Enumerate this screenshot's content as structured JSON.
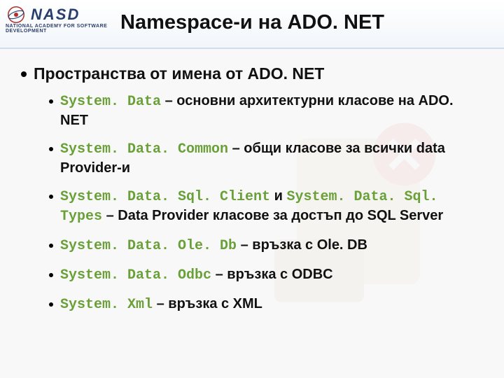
{
  "logo": {
    "text": "NASD",
    "subtitle": "NATIONAL ACADEMY FOR SOFTWARE DEVELOPMENT"
  },
  "title": "Namespace-и на ADO. NET",
  "heading": "Пространства от имена от ADO. NET",
  "items": [
    {
      "code1": "System. Data",
      "sep1": " – ",
      "text1": "основни архитектурни класове на ADO. NET"
    },
    {
      "code1": "System. Data. Common",
      "sep1": " – ",
      "text1": "общи класове за всички data Provider-и"
    },
    {
      "code1": "System. Data. Sql. Client",
      "sep1": " и ",
      "code2": "System. Data. Sql. Types",
      "sep2": " – ",
      "text1": "Data Provider класове за достъп до SQL Server"
    },
    {
      "code1": "System. Data. Ole. Db",
      "sep1": " – ",
      "text1": "връзка с Ole. DB"
    },
    {
      "code1": "System. Data. Odbc",
      "sep1": " – ",
      "text1": "връзка с ODBC"
    },
    {
      "code1": "System. Xml",
      "sep1": " – ",
      "text1": "връзка с XML"
    }
  ]
}
